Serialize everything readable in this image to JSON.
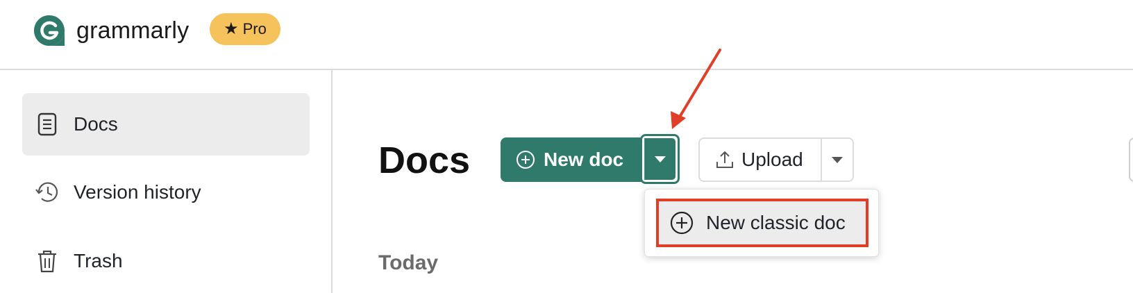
{
  "header": {
    "app_name": "grammarly",
    "badge_label": "Pro",
    "brand_color": "#2f7a6a",
    "badge_color": "#f5c25c"
  },
  "sidebar": {
    "items": [
      {
        "label": "Docs",
        "icon": "document-icon",
        "active": true
      },
      {
        "label": "Version history",
        "icon": "history-icon",
        "active": false
      },
      {
        "label": "Trash",
        "icon": "trash-icon",
        "active": false
      }
    ]
  },
  "main": {
    "title": "Docs",
    "new_doc_label": "New doc",
    "upload_label": "Upload",
    "section_today": "Today"
  },
  "menu": {
    "items": [
      {
        "label": "New classic doc",
        "icon": "plus-circle-icon"
      }
    ]
  },
  "annotation": {
    "highlight_color": "#e03e26"
  }
}
